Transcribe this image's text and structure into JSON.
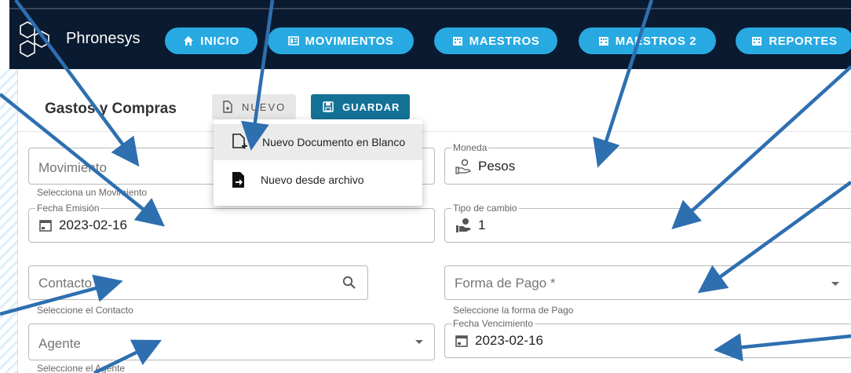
{
  "app": {
    "name": "Phronesys"
  },
  "nav": {
    "items": [
      {
        "label": "INICIO",
        "icon": "home-icon"
      },
      {
        "label": "MOVIMIENTOS",
        "icon": "list-box-icon"
      },
      {
        "label": "MAESTROS",
        "icon": "building-icon"
      },
      {
        "label": "MAESTROS 2",
        "icon": "building-icon"
      },
      {
        "label": "REPORTES",
        "icon": "building-icon"
      }
    ]
  },
  "page": {
    "title": "Gastos y Compras"
  },
  "toolbar": {
    "nuevo_label": "NUEVO",
    "guardar_label": "GUARDAR"
  },
  "menu": {
    "items": [
      {
        "label": "Nuevo Documento en Blanco",
        "icon": "file-plus-icon"
      },
      {
        "label": "Nuevo desde archivo",
        "icon": "file-import-icon"
      }
    ]
  },
  "form": {
    "movimiento": {
      "placeholder": "Movimiento",
      "hint": "Selecciona un Movimiento"
    },
    "fecha_emision": {
      "label": "Fecha Emisión",
      "value": "2023-02-16"
    },
    "contacto": {
      "placeholder": "Contacto *",
      "hint": "Seleccione el Contacto"
    },
    "agente": {
      "placeholder": "Agente",
      "hint": "Seleccione el Agente"
    },
    "moneda": {
      "label": "Moneda",
      "value": "Pesos"
    },
    "tipo_cambio": {
      "label": "Tipo de cambio",
      "value": "1"
    },
    "forma_pago": {
      "placeholder": "Forma de Pago *",
      "hint": "Seleccione la forma de Pago"
    },
    "fecha_vencimiento": {
      "label": "Fecha Vencimiento",
      "value": "2023-02-16"
    }
  },
  "colors": {
    "nav_bg": "#0a1a30",
    "nav_button": "#28a9e1",
    "guardar": "#137196",
    "arrow": "#2e6fb0"
  }
}
